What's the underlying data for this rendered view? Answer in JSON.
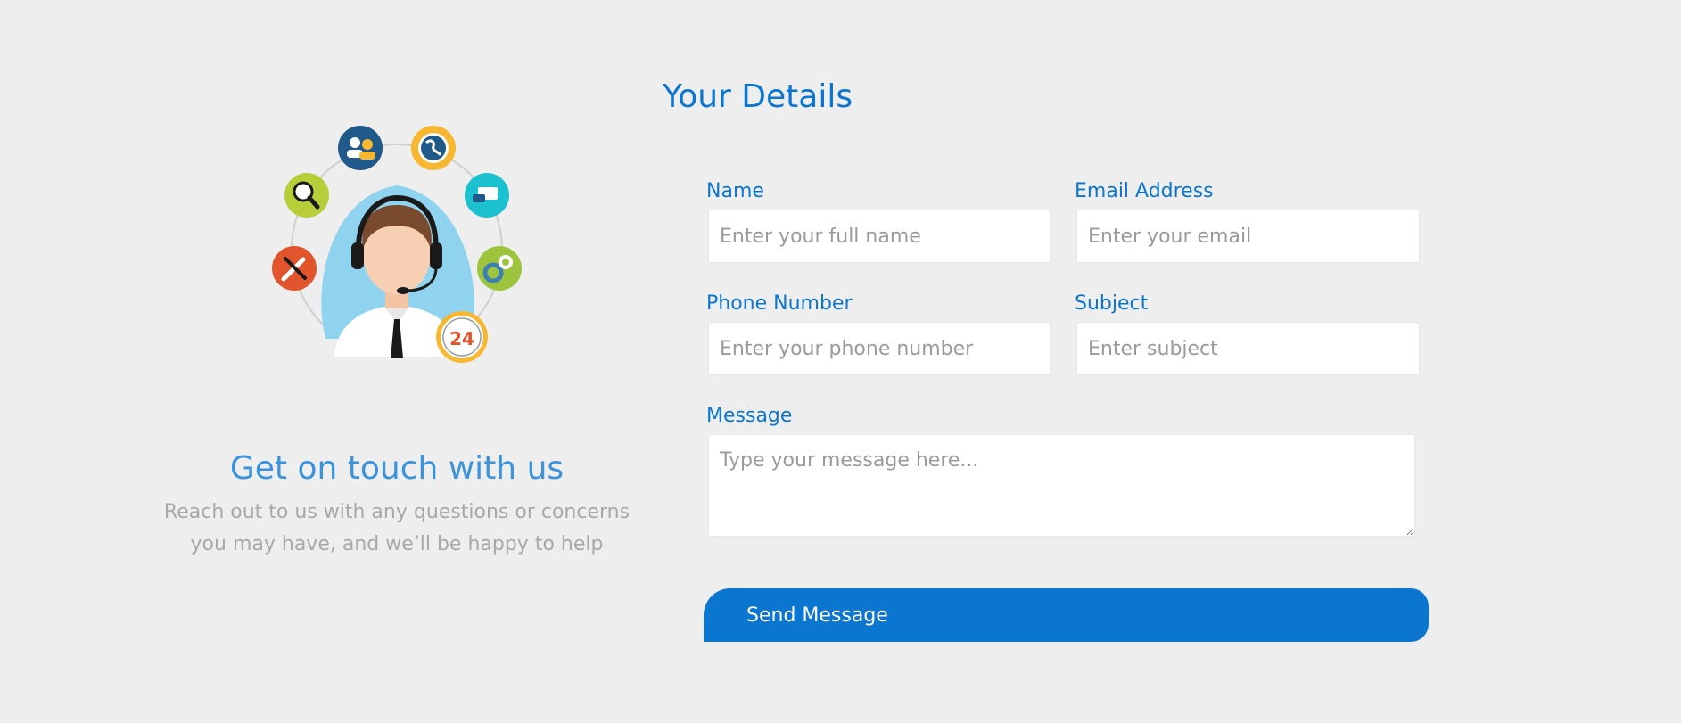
{
  "left": {
    "title": "Get on touch with us",
    "subtitle_line1": "Reach out to us with any questions or concerns",
    "subtitle_line2": "you may have, and we’ll be happy to help",
    "illustration_badge": "24"
  },
  "form": {
    "title": "Your Details",
    "name": {
      "label": "Name",
      "placeholder": "Enter your full name",
      "value": ""
    },
    "email": {
      "label": "Email Address",
      "placeholder": "Enter your email",
      "value": ""
    },
    "phone": {
      "label": "Phone Number",
      "placeholder": "Enter your phone number",
      "value": ""
    },
    "subject": {
      "label": "Subject",
      "placeholder": "Enter subject",
      "value": ""
    },
    "message": {
      "label": "Message",
      "placeholder": "Type your message here...",
      "value": ""
    },
    "submit_label": "Send Message"
  },
  "colors": {
    "background": "#eeeeee",
    "accent": "#0b76d0",
    "left_title": "#3b93dc",
    "muted_text": "#a8a8a8",
    "placeholder": "#9a9a9a"
  },
  "icons": [
    "support-agent-illustration",
    "users-icon",
    "globe-icon",
    "chat-icon",
    "gears-icon",
    "clock-24-icon",
    "tools-icon",
    "search-icon"
  ]
}
